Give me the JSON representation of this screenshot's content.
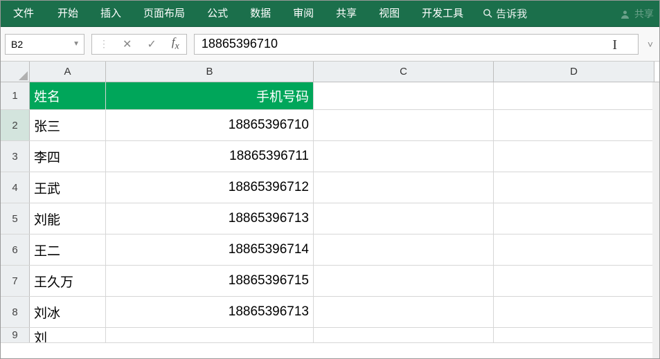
{
  "ribbon": {
    "tabs": [
      "文件",
      "开始",
      "插入",
      "页面布局",
      "公式",
      "数据",
      "审阅",
      "共享",
      "视图",
      "开发工具"
    ],
    "tellme": "告诉我",
    "share": "共享"
  },
  "formula_bar": {
    "namebox": "B2",
    "value": "18865396710"
  },
  "columns": [
    "A",
    "B",
    "C",
    "D"
  ],
  "header_row": {
    "num": "1",
    "colA": "姓名",
    "colB": "手机号码"
  },
  "data_rows": [
    {
      "num": "2",
      "colA": "张三",
      "colB": "18865396710"
    },
    {
      "num": "3",
      "colA": "李四",
      "colB": "18865396711"
    },
    {
      "num": "4",
      "colA": "王武",
      "colB": "18865396712"
    },
    {
      "num": "5",
      "colA": "刘能",
      "colB": "18865396713"
    },
    {
      "num": "6",
      "colA": "王二",
      "colB": "18865396714"
    },
    {
      "num": "7",
      "colA": "王久万",
      "colB": "18865396715"
    },
    {
      "num": "8",
      "colA": "刘冰",
      "colB": "18865396713"
    }
  ],
  "partial_row": {
    "num": "9",
    "colA": "刘",
    "colB": ""
  },
  "selected_cell": "B2"
}
